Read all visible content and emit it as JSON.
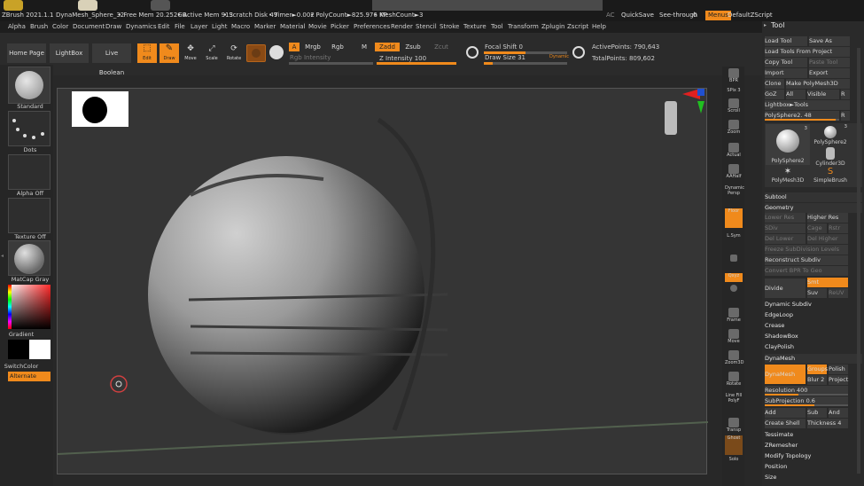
{
  "titlebar": {
    "app": "ZBrush 2021.1.1",
    "doc": "DynaMesh_Sphere_32",
    "free_mem": "• Free Mem 20.252GB",
    "active_mem": "• Active Mem 913",
    "scratch": "• Scratch Disk 49",
    "timer": "• Timer►0.002",
    "polycount": "• PolyCount►825.976 KP",
    "meshcount": "• MeshCount►3",
    "ac": "AC",
    "quicksave": "QuickSave",
    "seethrough": "See-through",
    "seethrough_val": "0",
    "menus": "Menus",
    "defaultzscript": "DefaultZScript"
  },
  "menu": [
    "Alpha",
    "Brush",
    "Color",
    "Document",
    "Draw",
    "Dynamics",
    "Edit",
    "File",
    "Layer",
    "Light",
    "Macro",
    "Marker",
    "Material",
    "Movie",
    "Picker",
    "Preferences",
    "Render",
    "Stencil",
    "Stroke",
    "Texture",
    "Tool",
    "Transform",
    "Zplugin",
    "Zscript",
    "Help"
  ],
  "shelf": {
    "home": "Home Page",
    "lightbox": "LightBox",
    "liveboolean": "Live Boolean",
    "edit": "Edit",
    "draw": "Draw",
    "move": "Move",
    "scale": "Scale",
    "rotate": "Rotate",
    "a": "A",
    "mrgb": "Mrgb",
    "rgb": "Rgb",
    "m": "M",
    "zadd": "Zadd",
    "zsub": "Zsub",
    "zcut": "Zcut",
    "rgb_intensity": "Rgb Intensity",
    "z_intensity": "Z Intensity 100",
    "focal_shift": "Focal Shift 0",
    "draw_size": "Draw Size 31",
    "dynamic": "Dynamic",
    "active_points": "ActivePoints: 790,643",
    "total_points": "TotalPoints: 809,602"
  },
  "lefttray": {
    "standard": "Standard",
    "dots": "Dots",
    "alpha_off": "Alpha Off",
    "texture_off": "Texture Off",
    "matcap": "MatCap Gray",
    "gradient": "Gradient",
    "switchcolor": "SwitchColor",
    "alternate": "Alternate"
  },
  "rshelf": [
    "BPR",
    "SPix 3",
    "Scroll",
    "Zoom",
    "Actual",
    "AAHalf",
    "Dynamic Persp",
    "Floor",
    "L.Sym",
    "Qxyz",
    "",
    "Frame",
    "Move",
    "Zoom3D",
    "Rotate",
    "Line Fill PolyF",
    "Transp",
    "Ghost",
    "Solo"
  ],
  "tool": {
    "title": "Tool",
    "load_tool": "Load Tool",
    "save_as": "Save As",
    "load_from_project": "Load Tools From Project",
    "copy_tool": "Copy Tool",
    "paste_tool": "Paste Tool",
    "import": "Import",
    "export": "Export",
    "clone": "Clone",
    "make_polymesh": "Make PolyMesh3D",
    "goz": "GoZ",
    "all": "All",
    "visible": "Visible",
    "r": "R",
    "lightbox_tools": "Lightbox►Tools",
    "polysphere2": "PolySphere2. 48",
    "thumbs": [
      {
        "label": "PolySphere2",
        "count": "3"
      },
      {
        "label": "PolySphere2",
        "count": "3"
      },
      {
        "label": "PolySphere2",
        "count": ""
      },
      {
        "label": "Cylinder3D",
        "count": ""
      },
      {
        "label": "PolyMesh3D",
        "count": ""
      },
      {
        "label": "SimpleBrush",
        "count": ""
      }
    ],
    "subtool": "Subtool",
    "geometry": "Geometry",
    "lower_res": "Lower Res",
    "higher_res": "Higher Res",
    "sdiv": "SDiv",
    "cage": "Cage",
    "rstr": "Rstr",
    "del_lower": "Del Lower",
    "del_higher": "Del Higher",
    "freeze": "Freeze SubDivision Levels",
    "reconstruct": "Reconstruct Subdiv",
    "convert_bpr": "Convert BPR To Geo",
    "divide": "Divide",
    "smt": "Smt",
    "suv": "Suv",
    "reuv": "ReUV",
    "dynamic_subdiv": "Dynamic Subdiv",
    "edgeloop": "EdgeLoop",
    "crease": "Crease",
    "shadowbox": "ShadowBox",
    "claypolish": "ClayPolish",
    "dynamesh_section": "DynaMesh",
    "dynamesh_btn": "DynaMesh",
    "groups": "Groups",
    "polish": "Polish",
    "blur": "Blur 2",
    "project": "Project",
    "resolution": "Resolution 400",
    "subprojection": "SubProjection 0.6",
    "add": "Add",
    "sub": "Sub",
    "and": "And",
    "create_shell": "Create Shell",
    "thickness": "Thickness 4",
    "tessimate": "Tessimate",
    "zremesher": "ZRemesher",
    "modify_topology": "Modify Topology",
    "position": "Position",
    "size": "Size"
  },
  "colors": {
    "accent": "#f08a1c",
    "bg": "#282828"
  }
}
